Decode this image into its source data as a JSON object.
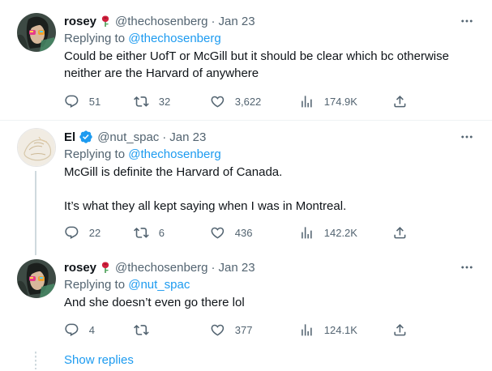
{
  "tweets": [
    {
      "name": "rosey",
      "handle": "@thechosenberg",
      "sep": "·",
      "date": "Jan 23",
      "replying_prefix": "Replying to",
      "replying_to": "@thechosenberg",
      "text_lines": [
        "Could be either UofT or McGill but it should be clear which bc otherwise",
        "neither are the Harvard of anywhere"
      ],
      "replies": "51",
      "retweets": "32",
      "likes": "3,622",
      "views": "174.9K",
      "name_emoji": "rose-icon"
    },
    {
      "name": "El",
      "handle": "@nut_spac",
      "sep": "·",
      "date": "Jan 23",
      "replying_prefix": "Replying to",
      "replying_to": "@thechosenberg",
      "text_para1": "McGill is definite the Harvard of Canada.",
      "text_para2": "It’s what they all kept saying when I was in Montreal.",
      "replies": "22",
      "retweets": "6",
      "likes": "436",
      "views": "142.2K",
      "badge": "verified-badge-icon"
    },
    {
      "name": "rosey",
      "handle": "@thechosenberg",
      "sep": "·",
      "date": "Jan 23",
      "replying_prefix": "Replying to",
      "replying_to": "@nut_spac",
      "text": "And she doesn’t even go there lol",
      "replies": "4",
      "retweets": "",
      "likes": "377",
      "views": "124.1K",
      "name_emoji": "rose-icon"
    }
  ],
  "show_replies": "Show replies",
  "colors": {
    "text": "#0f1419",
    "secondary": "#536471",
    "accent": "#1d9bf0",
    "divider": "#eff3f4",
    "thread_line": "#cfd9de"
  }
}
